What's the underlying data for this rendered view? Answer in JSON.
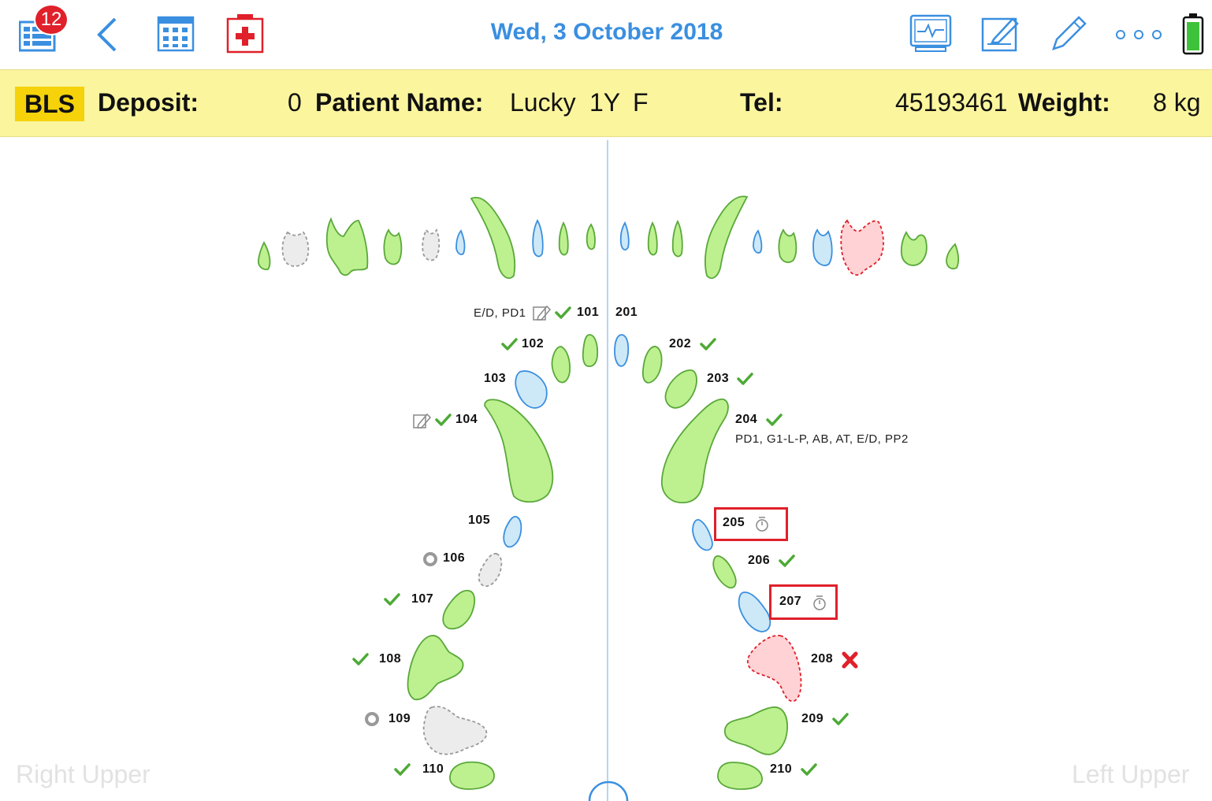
{
  "toolbar": {
    "badge_count": "12",
    "date": "Wed, 3 October 2018",
    "icons": [
      "list-icon",
      "back-chevron-icon",
      "calendar-icon",
      "medical-kit-icon",
      "monitor-icon",
      "edit-note-icon",
      "pencil-icon",
      "more-icon",
      "battery-icon"
    ]
  },
  "patient": {
    "tag": "BLS",
    "deposit_label": "Deposit:",
    "deposit_value": "0",
    "name_label": "Patient Name:",
    "name": "Lucky",
    "age": "1Y",
    "sex": "F",
    "tel_label": "Tel:",
    "tel": "45193461",
    "weight_label": "Weight:",
    "weight": "8 kg"
  },
  "quadrants": {
    "right": "Right Upper",
    "left": "Left Upper"
  },
  "teeth": {
    "t101": "101",
    "t102": "102",
    "t103": "103",
    "t104": "104",
    "t105": "105",
    "t106": "106",
    "t107": "107",
    "t108": "108",
    "t109": "109",
    "t110": "110",
    "t201": "201",
    "t202": "202",
    "t203": "203",
    "t204": "204",
    "t205": "205",
    "t206": "206",
    "t207": "207",
    "t208": "208",
    "t209": "209",
    "t210": "210"
  },
  "notes": {
    "n101": "E/D, PD1",
    "n204": "PD1, G1-L-P, AB, AT, E/D, PP2"
  },
  "colors": {
    "accent": "#3a8fe0",
    "healthy": "#bdf08f",
    "treated": "#cde9f7",
    "missing": "#ececec",
    "extracted": "#ffd3d6",
    "check": "#4caa35",
    "cross": "#e0202a"
  }
}
